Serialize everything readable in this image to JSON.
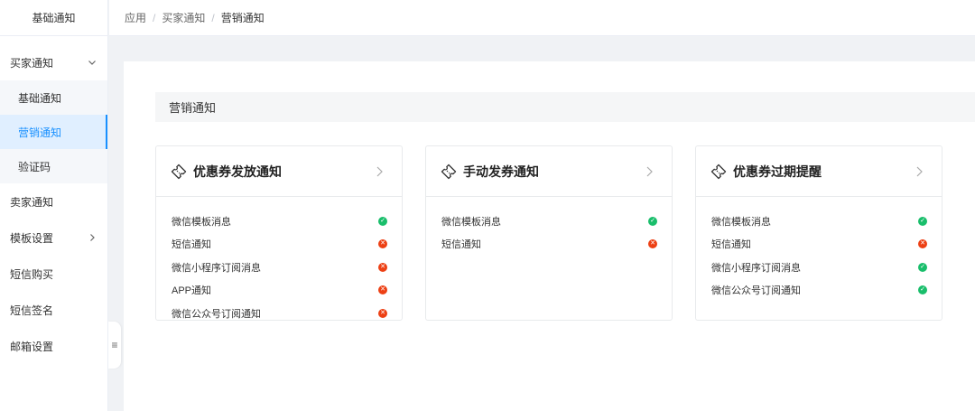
{
  "sidebar": {
    "header": "基础通知",
    "groups": [
      {
        "label": "买家通知",
        "expanded": true,
        "arrow": "⌄",
        "children": [
          {
            "label": "基础通知",
            "active": false
          },
          {
            "label": "营销通知",
            "active": true
          },
          {
            "label": "验证码",
            "active": false
          }
        ]
      },
      {
        "label": "卖家通知"
      },
      {
        "label": "模板设置",
        "arrow": "›"
      },
      {
        "label": "短信购买"
      },
      {
        "label": "短信签名"
      },
      {
        "label": "邮箱设置"
      }
    ],
    "collapse_icon": "≡"
  },
  "breadcrumb": {
    "items": [
      "应用",
      "买家通知",
      "营销通知"
    ],
    "separator": "/"
  },
  "section": {
    "title": "营销通知"
  },
  "cards": [
    {
      "title": "优惠券发放通知",
      "icon": "ticket-icon",
      "rows": [
        {
          "label": "微信模板消息",
          "status": "ok"
        },
        {
          "label": "短信通知",
          "status": "no"
        },
        {
          "label": "微信小程序订阅消息",
          "status": "no"
        },
        {
          "label": "APP通知",
          "status": "no"
        },
        {
          "label": "微信公众号订阅通知",
          "status": "no"
        }
      ]
    },
    {
      "title": "手动发券通知",
      "icon": "ticket-icon",
      "rows": [
        {
          "label": "微信模板消息",
          "status": "ok"
        },
        {
          "label": "短信通知",
          "status": "no"
        }
      ]
    },
    {
      "title": "优惠券过期提醒",
      "icon": "ticket-icon",
      "rows": [
        {
          "label": "微信模板消息",
          "status": "ok"
        },
        {
          "label": "短信通知",
          "status": "no"
        },
        {
          "label": "微信小程序订阅消息",
          "status": "ok"
        },
        {
          "label": "微信公众号订阅通知",
          "status": "ok"
        }
      ]
    }
  ],
  "colors": {
    "accent": "#1890ff",
    "ok": "#19be6b",
    "error": "#ed4014"
  }
}
